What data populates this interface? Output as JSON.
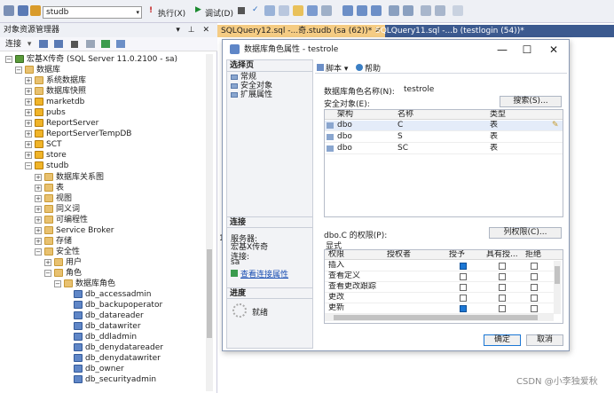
{
  "toolbar": {
    "db_selector": "studb",
    "execute_label": "执行(X)",
    "debug_label": "调试(D)"
  },
  "object_explorer": {
    "title": "对象资源管理器",
    "connect_label": "连接",
    "items": [
      {
        "label": "宏基X传奇 (SQL Server 11.0.2100 - sa)",
        "depth": 0,
        "expanded": true,
        "icon": "server-icon"
      },
      {
        "label": "数据库",
        "depth": 1,
        "expanded": true,
        "icon": "folder-icon"
      },
      {
        "label": "系统数据库",
        "depth": 2,
        "expanded": false,
        "icon": "folder-icon"
      },
      {
        "label": "数据库快照",
        "depth": 2,
        "expanded": false,
        "icon": "folder-icon"
      },
      {
        "label": "marketdb",
        "depth": 2,
        "expanded": false,
        "icon": "database-icon"
      },
      {
        "label": "pubs",
        "depth": 2,
        "expanded": false,
        "icon": "database-icon"
      },
      {
        "label": "ReportServer",
        "depth": 2,
        "expanded": false,
        "icon": "database-icon"
      },
      {
        "label": "ReportServerTempDB",
        "depth": 2,
        "expanded": false,
        "icon": "database-icon"
      },
      {
        "label": "SCT",
        "depth": 2,
        "expanded": false,
        "icon": "database-icon"
      },
      {
        "label": "store",
        "depth": 2,
        "expanded": false,
        "icon": "database-icon"
      },
      {
        "label": "studb",
        "depth": 2,
        "expanded": true,
        "icon": "database-icon"
      },
      {
        "label": "数据库关系图",
        "depth": 3,
        "expanded": false,
        "icon": "folder-icon"
      },
      {
        "label": "表",
        "depth": 3,
        "expanded": false,
        "icon": "folder-icon"
      },
      {
        "label": "视图",
        "depth": 3,
        "expanded": false,
        "icon": "folder-icon"
      },
      {
        "label": "同义词",
        "depth": 3,
        "expanded": false,
        "icon": "folder-icon"
      },
      {
        "label": "可编程性",
        "depth": 3,
        "expanded": false,
        "icon": "folder-icon"
      },
      {
        "label": "Service Broker",
        "depth": 3,
        "expanded": false,
        "icon": "folder-icon"
      },
      {
        "label": "存储",
        "depth": 3,
        "expanded": false,
        "icon": "folder-icon"
      },
      {
        "label": "安全性",
        "depth": 3,
        "expanded": true,
        "icon": "folder-icon"
      },
      {
        "label": "用户",
        "depth": 4,
        "expanded": false,
        "icon": "folder-icon"
      },
      {
        "label": "角色",
        "depth": 4,
        "expanded": true,
        "icon": "folder-icon"
      },
      {
        "label": "数据库角色",
        "depth": 5,
        "expanded": true,
        "icon": "folder-icon"
      },
      {
        "label": "db_accessadmin",
        "depth": 6,
        "icon": "role-icon"
      },
      {
        "label": "db_backupoperator",
        "depth": 6,
        "icon": "role-icon"
      },
      {
        "label": "db_datareader",
        "depth": 6,
        "icon": "role-icon"
      },
      {
        "label": "db_datawriter",
        "depth": 6,
        "icon": "role-icon"
      },
      {
        "label": "db_ddladmin",
        "depth": 6,
        "icon": "role-icon"
      },
      {
        "label": "db_denydatareader",
        "depth": 6,
        "icon": "role-icon"
      },
      {
        "label": "db_denydatawriter",
        "depth": 6,
        "icon": "role-icon"
      },
      {
        "label": "db_owner",
        "depth": 6,
        "icon": "role-icon"
      },
      {
        "label": "db_securityadmin",
        "depth": 6,
        "icon": "role-icon"
      }
    ]
  },
  "tabs": [
    {
      "label": "SQLQuery12.sql -...奇.studb (sa (62))*",
      "active": true
    },
    {
      "label": "SQLQuery11.sql -...b (testlogin (54))*",
      "active": false
    }
  ],
  "dialog": {
    "title": "数据库角色属性 - testrole",
    "select_page_header": "选择页",
    "pages": [
      "常规",
      "安全对象",
      "扩展属性"
    ],
    "script_label": "脚本",
    "help_label": "帮助",
    "role_name_label": "数据库角色名称(N):",
    "role_name_value": "testrole",
    "securables_label": "安全对象(E):",
    "search_button": "搜索(S)...",
    "securables_columns": [
      "架构",
      "名称",
      "类型"
    ],
    "securables_rows": [
      {
        "schema": "dbo",
        "name": "C",
        "type": "表"
      },
      {
        "schema": "dbo",
        "name": "S",
        "type": "表"
      },
      {
        "schema": "dbo",
        "name": "SC",
        "type": "表"
      }
    ],
    "connection_header": "连接",
    "server_label": "服务器:",
    "server_value": "宏基X传奇",
    "conn_label": "连接:",
    "conn_value": "sa",
    "view_conn_link": "查看连接属性",
    "progress_header": "进度",
    "progress_status": "就绪",
    "perm_label": "dbo.C 的权限(P):",
    "col_perm_button": "列权限(C)...",
    "explicit_tab": "显式",
    "perm_columns": [
      "权限",
      "授权者",
      "授予",
      "具有授...",
      "拒绝"
    ],
    "perm_rows": [
      {
        "name": "插入",
        "grant": true,
        "with_grant": false,
        "deny": false
      },
      {
        "name": "查看定义",
        "grant": false,
        "with_grant": false,
        "deny": false
      },
      {
        "name": "查看更改跟踪",
        "grant": false,
        "with_grant": false,
        "deny": false
      },
      {
        "name": "更改",
        "grant": false,
        "with_grant": false,
        "deny": false
      },
      {
        "name": "更新",
        "grant": true,
        "with_grant": false,
        "deny": false
      }
    ],
    "ok_button": "确定",
    "cancel_button": "取消"
  },
  "watermark": "CSDN @小李独爱秋",
  "partial_text": "1("
}
